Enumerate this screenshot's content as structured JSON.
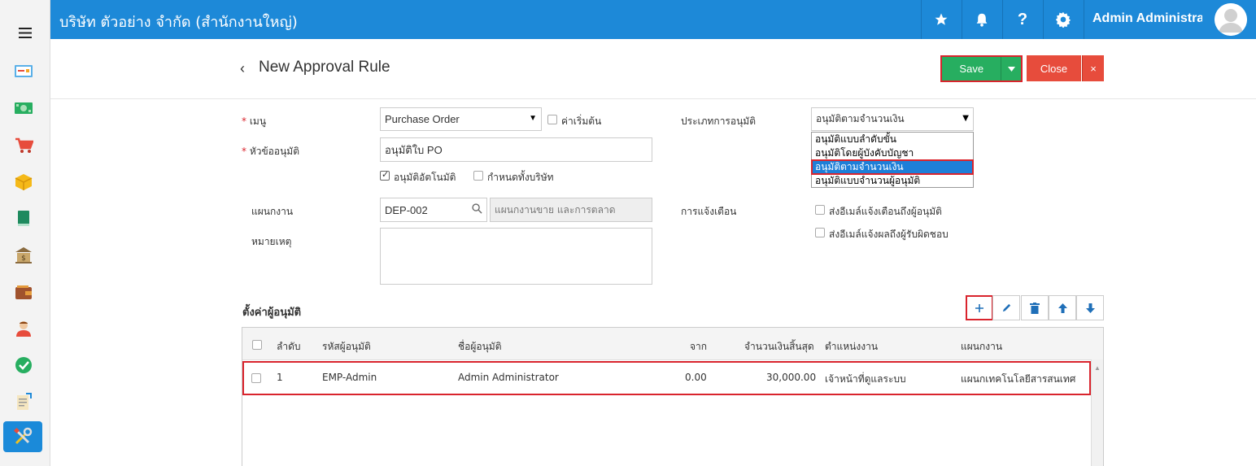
{
  "topbar": {
    "company": "บริษัท ตัวอย่าง จำกัด (สำนักงานใหญ่)",
    "user_name": "Admin Administrator"
  },
  "header": {
    "title": "New Approval Rule",
    "save_label": "Save",
    "close_label": "Close"
  },
  "form": {
    "menu_label": "เมนู",
    "menu_value": "Purchase Order",
    "default_label": "ค่าเริ่มต้น",
    "subject_label": "หัวข้ออนุมัติ",
    "subject_value": "อนุมัติใบ PO",
    "auto_approve_label": "อนุมัติอัตโนมัติ",
    "auto_approve_checked": true,
    "company_wide_label": "กำหนดทั้งบริษัท",
    "department_label": "แผนกงาน",
    "department_code": "DEP-002",
    "department_name": "แผนกงานขาย และการตลาด",
    "remark_label": "หมายเหตุ",
    "approval_type_label": "ประเภทการอนุมัติ",
    "approval_type_value": "อนุมัติตามจำนวนเงิน",
    "approval_type_options": [
      "อนุมัติแบบลำดับขั้น",
      "อนุมัติโดยผู้บังคับบัญชา",
      "อนุมัติตามจำนวนเงิน",
      "อนุมัติแบบจำนวนผู้อนุมัติ"
    ],
    "notify_label": "การแจ้งเตือน",
    "notify_approver_label": "ส่งอีเมล์แจ้งเตือนถึงผู้อนุมัติ",
    "notify_owner_label": "ส่งอีเมล์แจ้งผลถึงผู้รับผิดชอบ"
  },
  "approvers": {
    "title": "ตั้งค่าผู้อนุมัติ",
    "columns": {
      "seq": "ลำดับ",
      "code": "รหัสผู้อนุมัติ",
      "name": "ชื่อผู้อนุมัติ",
      "from": "จาก",
      "max": "จำนวนเงินสิ้นสุด",
      "position": "ตำแหน่งงาน",
      "department": "แผนกงาน"
    },
    "rows": [
      {
        "seq": "1",
        "code": "EMP-Admin",
        "name": "Admin Administrator",
        "from": "0.00",
        "max": "30,000.00",
        "position": "เจ้าหน้าที่ดูแลระบบ",
        "department": "แผนกเทคโนโลยีสารสนเทศ"
      }
    ]
  },
  "colors": {
    "topbar": "#1d89d8",
    "save": "#27ae60",
    "close": "#e74c3c",
    "highlight": "#d9242d"
  }
}
